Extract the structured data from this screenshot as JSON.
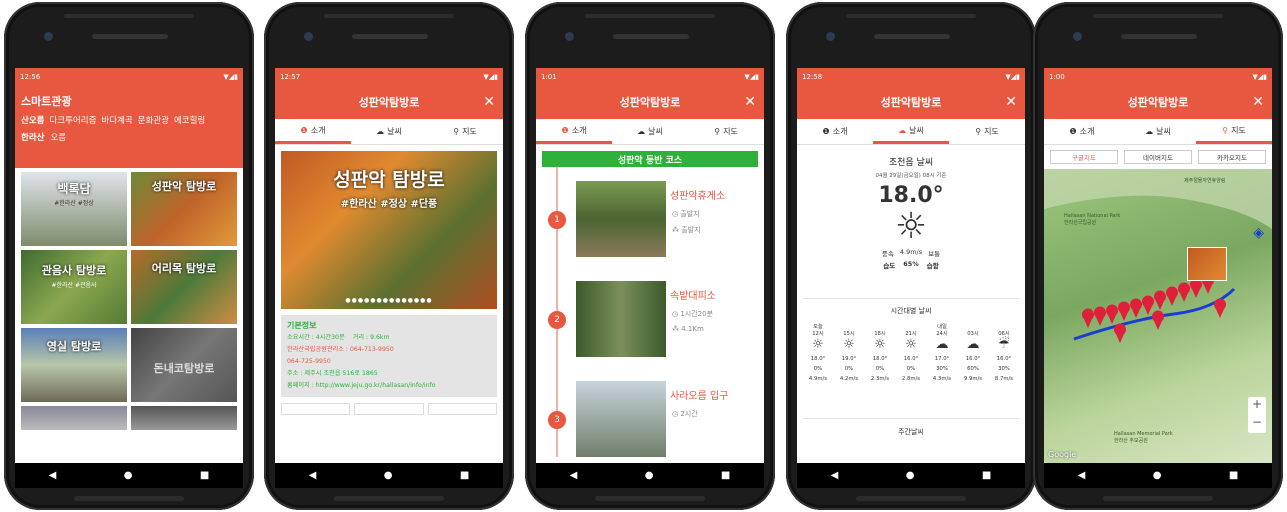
{
  "colors": {
    "accent": "#e8573f",
    "green": "#2eb13a",
    "map_green": "#8bb870"
  },
  "screen1": {
    "status_time": "12:56",
    "title": "스마트관광",
    "categories": [
      "산오름",
      "다크투어리즘",
      "바다계곡",
      "문화관광",
      "에코힐링"
    ],
    "subcategories": [
      "한라산",
      "오름"
    ],
    "tiles": [
      {
        "title": "백록담",
        "tags": "#한라산 #정상"
      },
      {
        "title": "성판악 탐방로",
        "tags": ""
      },
      {
        "title": "관음사 탐방로",
        "tags": "#한라산 #관음사"
      },
      {
        "title": "어리목 탐방로",
        "tags": ""
      },
      {
        "title": "영실 탐방로",
        "tags": ""
      },
      {
        "title": "돈내코탐방로",
        "tags": ""
      }
    ]
  },
  "screen2": {
    "status_time": "12:57",
    "title": "성판악탐방로",
    "tabs": [
      "소개",
      "날씨",
      "지도"
    ],
    "banner_title": "성판악 탐방로",
    "banner_tags": "#한라산 #정상 #단풍",
    "info_title": "기본정보",
    "info_time_label": "소요시간 : 4시간30분",
    "info_distance_label": "거리 : 9.6km",
    "info_office": "한라산국립공원관리소 : 064-713-9950",
    "info_office_phone2": "064-725-9950",
    "info_address": "주소 : 제주시 조천읍 516로 1865",
    "info_homepage_label": "홈페이지 :",
    "info_homepage_url": "http://www.jeju.go.kr/hallasan/info/info"
  },
  "screen3": {
    "status_time": "1:01",
    "title": "성판악탐방로",
    "tabs": [
      "소개",
      "날씨",
      "지도"
    ],
    "course_title": "성판악 등반 코스",
    "stops": [
      {
        "num": "1",
        "name": "성판악휴게소",
        "time": "출발지",
        "dist": "출발지"
      },
      {
        "num": "2",
        "name": "속밭대피소",
        "time": "1시간20분",
        "dist": "4.1Km"
      },
      {
        "num": "3",
        "name": "사라오름 입구",
        "time": "2시간",
        "dist": ""
      }
    ]
  },
  "screen4": {
    "status_time": "12:58",
    "title": "성판악탐방로",
    "tabs": [
      "소개",
      "날씨",
      "지도"
    ],
    "location": "조천읍 날씨",
    "timestamp": "04월 29일(금요일) 08시 기준",
    "temperature": "18.0°",
    "wind_label": "풍속",
    "wind_value": "4.9m/s",
    "wind_status": "보통",
    "humidity_label": "습도",
    "humidity_value": "65%",
    "humidity_status": "습함",
    "hourly_title": "시간대별 날씨",
    "hourly": [
      {
        "day": "오늘",
        "hour": "12시",
        "icon": "sun-icon",
        "temp": "18.0°",
        "rain": "0%",
        "wind": "4.9m/s"
      },
      {
        "day": "",
        "hour": "15시",
        "icon": "sun-icon",
        "temp": "19.0°",
        "rain": "0%",
        "wind": "4.2m/s"
      },
      {
        "day": "",
        "hour": "18시",
        "icon": "sun-icon",
        "temp": "18.0°",
        "rain": "0%",
        "wind": "2.3m/s"
      },
      {
        "day": "",
        "hour": "21시",
        "icon": "sun-icon",
        "temp": "16.0°",
        "rain": "0%",
        "wind": "2.8m/s"
      },
      {
        "day": "내일",
        "hour": "24시",
        "icon": "cloud-icon",
        "temp": "17.0°",
        "rain": "30%",
        "wind": "4.3m/s"
      },
      {
        "day": "",
        "hour": "03시",
        "icon": "cloud-icon",
        "temp": "16.0°",
        "rain": "60%",
        "wind": "9.9m/s"
      },
      {
        "day": "",
        "hour": "06시",
        "icon": "rain-icon",
        "temp": "16.0°",
        "rain": "30%",
        "wind": "8.7m/s"
      }
    ],
    "weekly_title": "주간날씨"
  },
  "screen5": {
    "status_time": "1:00",
    "title": "성판악탐방로",
    "tabs": [
      "소개",
      "날씨",
      "지도"
    ],
    "map_buttons": [
      "구글지도",
      "네이버지도",
      "카카오지도"
    ],
    "map_label_np": "Hallasan National Park",
    "map_label_np_kr": "한라산국립공원",
    "map_label_mem": "Hallasan Memorial Park",
    "map_label_mem_kr": "한라산 추모공원",
    "map_label_top": "제주절물자연휴양림",
    "google_logo": "Google",
    "zoom_in": "+",
    "zoom_out": "−"
  }
}
